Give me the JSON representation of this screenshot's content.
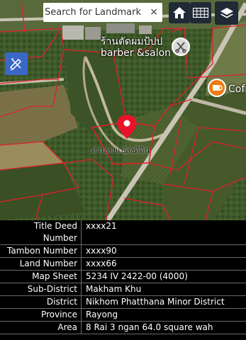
{
  "search": {
    "placeholder": "Search for Landmark",
    "clear_label": "×"
  },
  "toolbar": {
    "home_icon": "home-icon",
    "grid_icon": "grid-icon",
    "layers_icon": "layers-icon",
    "measure_icon": "measure-icon"
  },
  "map": {
    "pois": [
      {
        "name_thai": "ร้านตัดผมป้ปป",
        "name_en": "barber &salon",
        "icon": "barber-icon"
      },
      {
        "name_en": "Cof",
        "icon": "coffee-icon"
      }
    ],
    "parcel_label": "ตามหาแปลงที่ดิน",
    "pin_icon": "location-pin-icon",
    "parcel_border_color": "#e0202a"
  },
  "info": {
    "rows": [
      {
        "label": "Title Deed Number",
        "value": "xxxx21"
      },
      {
        "label": "Tambon Number",
        "value": "xxxx90"
      },
      {
        "label": "Land Number",
        "value": "xxxx66"
      },
      {
        "label": "Map Sheet",
        "value": "5234 IV 2422-00 (4000)"
      },
      {
        "label": "Sub-District",
        "value": "Makham Khu"
      },
      {
        "label": "District",
        "value": "Nikhom Phatthana Minor District"
      },
      {
        "label": "Province",
        "value": "Rayong"
      },
      {
        "label": "Area",
        "value": "8 Rai 3 ngan 64.0 square wah"
      }
    ]
  }
}
